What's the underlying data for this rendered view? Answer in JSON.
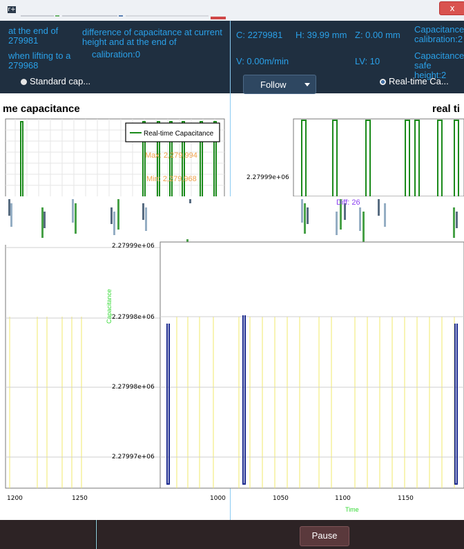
{
  "window": {
    "app_icon": "r+",
    "close_label": "x"
  },
  "left_panel": {
    "line1_a": "at the end of",
    "line1_b": "279981",
    "line2_a": "when lifting to a",
    "line2_b": "279968",
    "diff_a": "difference of capacitance at current",
    "diff_b": "height and at the end of",
    "diff_c": "calibration:0",
    "radio_label": "Standard cap..."
  },
  "right_panel": {
    "c": "C: 2279981",
    "h": "H: 39.99 mm",
    "z": "Z: 0.00 mm",
    "v": "V: 0.00m/min",
    "lv": "LV: 10",
    "cap1_a": "Capacitance",
    "cap1_b": "calibration:2",
    "cap2_a": "Capacitance",
    "cap2_b": "safe height:2",
    "follow_label": "Follow",
    "radio_label": "Real-time Ca..."
  },
  "left_chart": {
    "title": "me capacitance",
    "legend": "Real-time Capacitance",
    "max": "Max: 2,279,994",
    "min": "Min: 2,279,968",
    "x_ticks": [
      "1200",
      "1250"
    ]
  },
  "right_chart": {
    "title": "real ti",
    "top_tick": "2.27999e+06",
    "diff": "Diff: 26",
    "y_ticks": [
      "2.27999e+06",
      "2.27998e+06",
      "2.27998e+06",
      "2.27997e+06"
    ],
    "y_label": "Capacitance",
    "x_ticks": [
      "1000",
      "1050",
      "1100",
      "1150"
    ],
    "x_label": "Time"
  },
  "footer": {
    "pause_label": "Pause"
  },
  "colors": {
    "panel": "#1f2f40",
    "info_text": "#2aa0e8",
    "series": "#1a8a1a",
    "series_dark": "#1b2a8f",
    "annotation": "#f0a24a",
    "grid_yellow": "#f2e86a",
    "axis_label_green": "#33d933",
    "diff_purple": "#8a3ff0"
  }
}
